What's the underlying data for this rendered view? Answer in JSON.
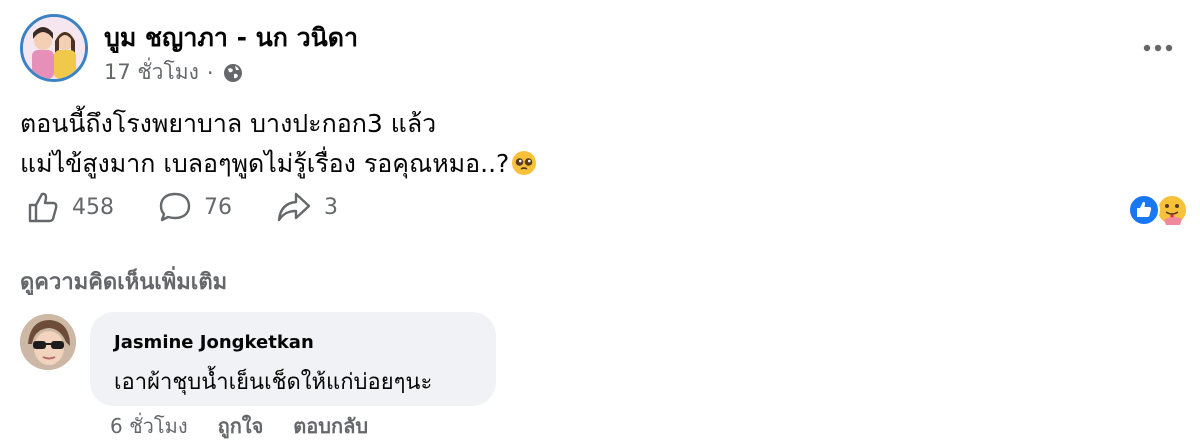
{
  "post": {
    "author": "บูม ชญาภา - นก วนิดา",
    "time": "17 ชั่วโมง",
    "separator": "·",
    "privacy_icon": "globe-icon",
    "text_lines": [
      "ตอนนี้ถึงโรงพยาบาล บางปะกอก3 แล้ว",
      "แม่ไข้สูงมาก เบลอๆพูดไม่รู้เรื่อง รอคุณหมอ..?"
    ],
    "emoji": "pleading-face-emoji",
    "likes_count": "458",
    "comments_count": "76",
    "shares_count": "3",
    "reaction_icons": [
      "like-reaction-icon",
      "care-reaction-icon"
    ],
    "accent_color": "#1877f2"
  },
  "comments_section": {
    "view_more_label": "ดูความคิดเห็นเพิ่มเติม",
    "comments": [
      {
        "author": "Jasmine Jongketkan",
        "text": "เอาผ้าชุบน้ำเย็นเช็ดให้แก่บ่อยๆนะ",
        "time": "6 ชั่วโมง",
        "like_label": "ถูกใจ",
        "reply_label": "ตอบกลับ"
      }
    ]
  }
}
